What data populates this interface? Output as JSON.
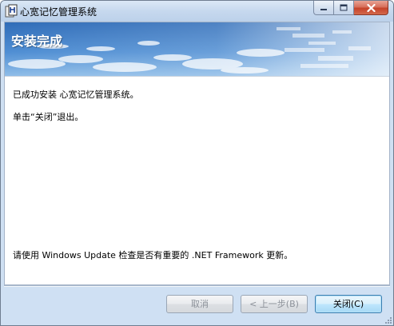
{
  "window": {
    "title": "心宽记忆管理系统"
  },
  "banner": {
    "title": "安装完成"
  },
  "content": {
    "line1": "已成功安装 心宽记忆管理系统。",
    "line2": "单击“关闭”退出。",
    "update_note": "请使用 Windows Update 检查是否有重要的 .NET Framework 更新。"
  },
  "buttons": {
    "cancel": "取消",
    "back": "< 上一步(B)",
    "close": "关闭(C)"
  },
  "colors": {
    "banner_sky_top": "#2f6cb8",
    "banner_sky_bottom": "#7fb2e3",
    "close_button_red": "#c5432a",
    "default_button_border": "#3c7fb1"
  }
}
